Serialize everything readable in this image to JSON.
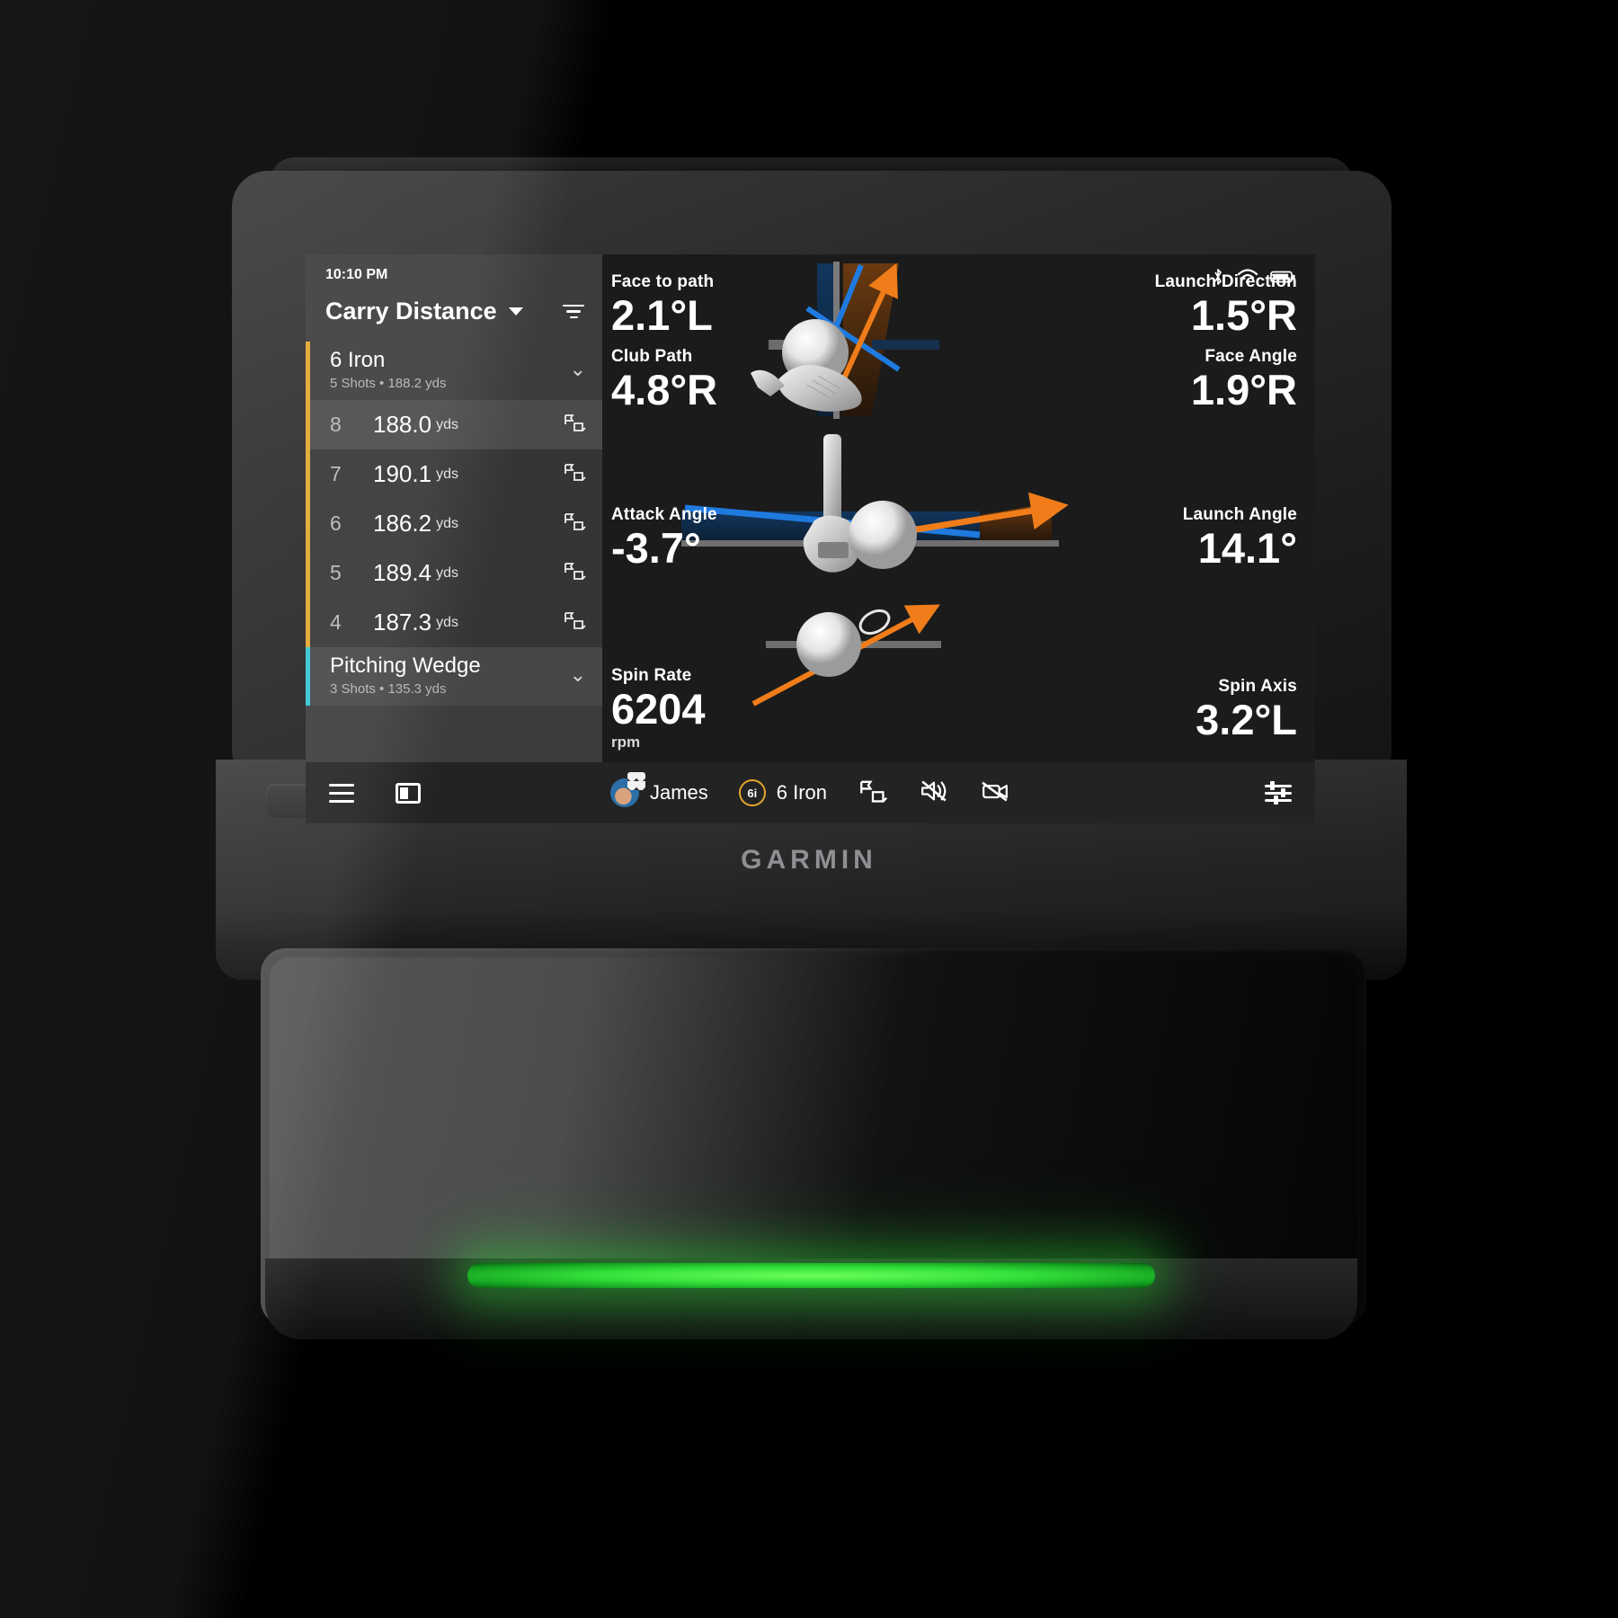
{
  "device": {
    "brand": "GARMIN"
  },
  "status": {
    "time": "10:10 PM",
    "icons": [
      "bluetooth-icon",
      "wifi-icon",
      "battery-icon"
    ]
  },
  "list": {
    "title": "Carry Distance",
    "dropdown_icon": "chevron-down-icon",
    "filter_icon": "filter-icon",
    "groups": [
      {
        "club": "6 Iron",
        "subtitle": "5 Shots • 188.2 yds",
        "shot_count": "5 Shots",
        "avg_distance": "188.2 yds",
        "accent": "#e2a72c",
        "expanded": true,
        "shots": [
          {
            "num": "8",
            "distance": "188.0",
            "unit": "yds",
            "selected": true
          },
          {
            "num": "7",
            "distance": "190.1",
            "unit": "yds",
            "selected": false
          },
          {
            "num": "6",
            "distance": "186.2",
            "unit": "yds",
            "selected": false
          },
          {
            "num": "5",
            "distance": "189.4",
            "unit": "yds",
            "selected": false
          },
          {
            "num": "4",
            "distance": "187.3",
            "unit": "yds",
            "selected": false
          }
        ]
      },
      {
        "club": "Pitching Wedge",
        "subtitle": "3 Shots • 135.3 yds",
        "shot_count": "3 Shots",
        "avg_distance": "135.3 yds",
        "accent": "#35c5d6",
        "expanded": false,
        "shots": []
      }
    ]
  },
  "metrics": {
    "left": [
      {
        "label": "Face to path",
        "value": "2.1°L",
        "unit": ""
      },
      {
        "label": "Club Path",
        "value": "4.8°R",
        "unit": ""
      },
      {
        "label": "Attack Angle",
        "value": "-3.7°",
        "unit": ""
      },
      {
        "label": "Spin Rate",
        "value": "6204",
        "unit": "rpm"
      }
    ],
    "right": [
      {
        "label": "Launch Direction",
        "value": "1.5°R",
        "unit": ""
      },
      {
        "label": "Face Angle",
        "value": "1.9°R",
        "unit": ""
      },
      {
        "label": "Launch Angle",
        "value": "14.1°",
        "unit": ""
      },
      {
        "label": "Spin Axis",
        "value": "3.2°L",
        "unit": ""
      }
    ]
  },
  "toolbar": {
    "menu_label": "menu",
    "panel_label": "panel",
    "player": "James",
    "club": "6 Iron",
    "club_badge": "6i",
    "flag_label": "flag-shot",
    "mute_label": "sound off",
    "video_label": "video off",
    "settings_label": "settings"
  },
  "colors": {
    "accent_iron": "#e2a72c",
    "accent_wedge": "#35c5d6",
    "arrow_orange": "#f07d1a",
    "arrow_blue": "#1f7ae0",
    "led_green": "#33e03a"
  }
}
